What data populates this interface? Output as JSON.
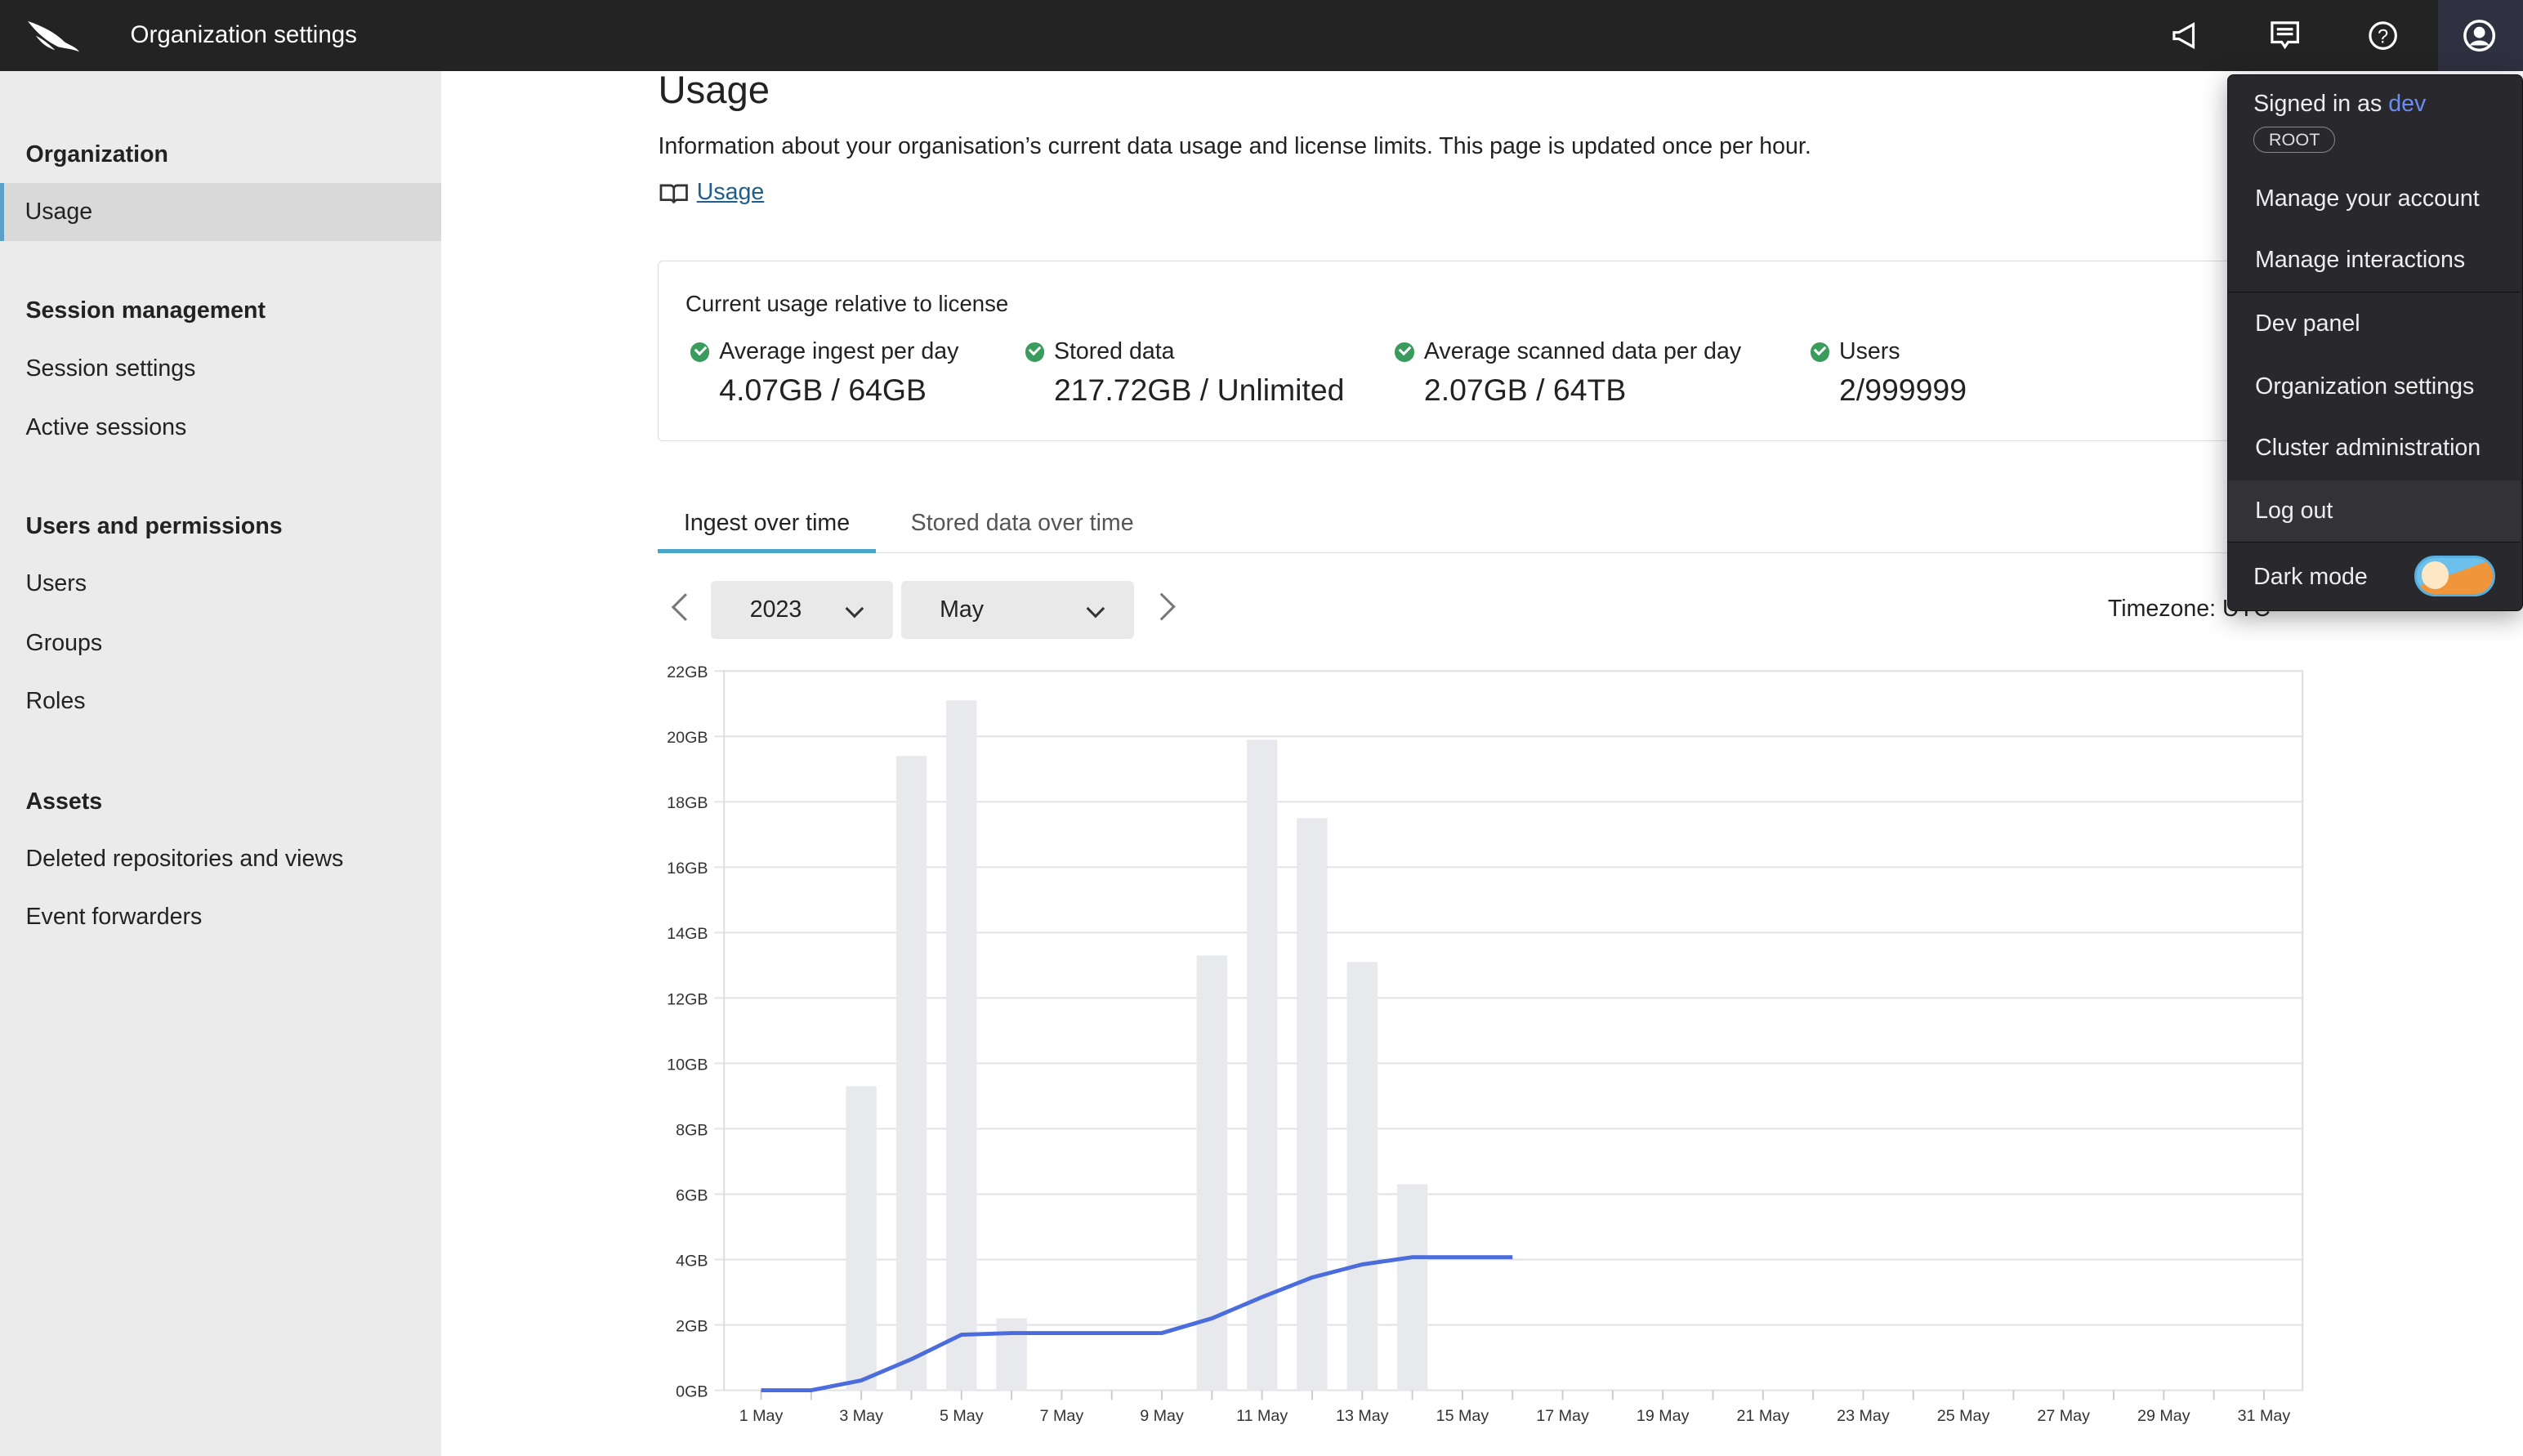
{
  "topbar": {
    "title": "Organization settings",
    "icons": [
      "logo-falcon",
      "megaphone-icon",
      "chat-icon",
      "help-icon",
      "user-icon"
    ]
  },
  "sidebar": {
    "sections": [
      {
        "title": "Organization",
        "items": [
          "Usage"
        ]
      },
      {
        "title": "Session management",
        "items": [
          "Session settings",
          "Active sessions"
        ]
      },
      {
        "title": "Users and permissions",
        "items": [
          "Users",
          "Groups",
          "Roles"
        ]
      },
      {
        "title": "Assets",
        "items": [
          "Deleted repositories and views",
          "Event forwarders"
        ]
      }
    ],
    "active": "Usage"
  },
  "page": {
    "title": "Usage",
    "description": "Information about your organisation’s current data usage and license limits. This page is updated once per hour.",
    "doc_link": "Usage",
    "card": {
      "title": "Current usage relative to license",
      "stats": [
        {
          "label": "Average ingest per day",
          "value": "4.07GB / 64GB"
        },
        {
          "label": "Stored data",
          "value": "217.72GB / Unlimited"
        },
        {
          "label": "Average scanned data per day",
          "value": "2.07GB / 64TB"
        },
        {
          "label": "Users",
          "value": "2/999999"
        }
      ],
      "status_color": "#3a9c5c"
    },
    "tabs": [
      "Ingest over time",
      "Stored data over time"
    ],
    "active_tab": "Ingest over time",
    "year": "2023",
    "month": "May",
    "timezone": "Timezone: UTC"
  },
  "menu": {
    "signed_in_prefix": "Signed in as",
    "username": "dev",
    "badge": "ROOT",
    "items": [
      "Manage your account",
      "Manage interactions",
      "Dev panel",
      "Organization settings",
      "Cluster administration",
      "Log out"
    ],
    "hovered": "Log out",
    "dark_mode_label": "Dark mode",
    "dark_mode": false
  },
  "chart_data": {
    "type": "bar",
    "ylim": [
      0,
      22
    ],
    "y_ticks": [
      "0GB",
      "2GB",
      "4GB",
      "6GB",
      "8GB",
      "10GB",
      "12GB",
      "14GB",
      "16GB",
      "18GB",
      "20GB",
      "22GB"
    ],
    "x_ticks": [
      "1 May",
      "3 May",
      "5 May",
      "7 May",
      "9 May",
      "11 May",
      "13 May",
      "15 May",
      "17 May",
      "19 May",
      "21 May",
      "23 May",
      "25 May",
      "27 May",
      "29 May",
      "31 May"
    ],
    "grid": true,
    "bars": {
      "color": "#e8e9ec",
      "days": [
        3,
        4,
        5,
        6,
        10,
        11,
        12,
        13,
        14
      ],
      "values": [
        9.3,
        19.4,
        21.1,
        2.2,
        13.3,
        19.9,
        17.5,
        13.1,
        6.3
      ]
    },
    "line": {
      "color": "#4a6cdc",
      "days": [
        1,
        2,
        3,
        4,
        5,
        6,
        7,
        8,
        9,
        10,
        11,
        12,
        13,
        14,
        15,
        16
      ],
      "values": [
        0,
        0,
        0.3,
        0.95,
        1.7,
        1.75,
        1.75,
        1.75,
        1.75,
        2.2,
        2.85,
        3.45,
        3.85,
        4.07,
        4.07,
        4.07
      ]
    }
  }
}
